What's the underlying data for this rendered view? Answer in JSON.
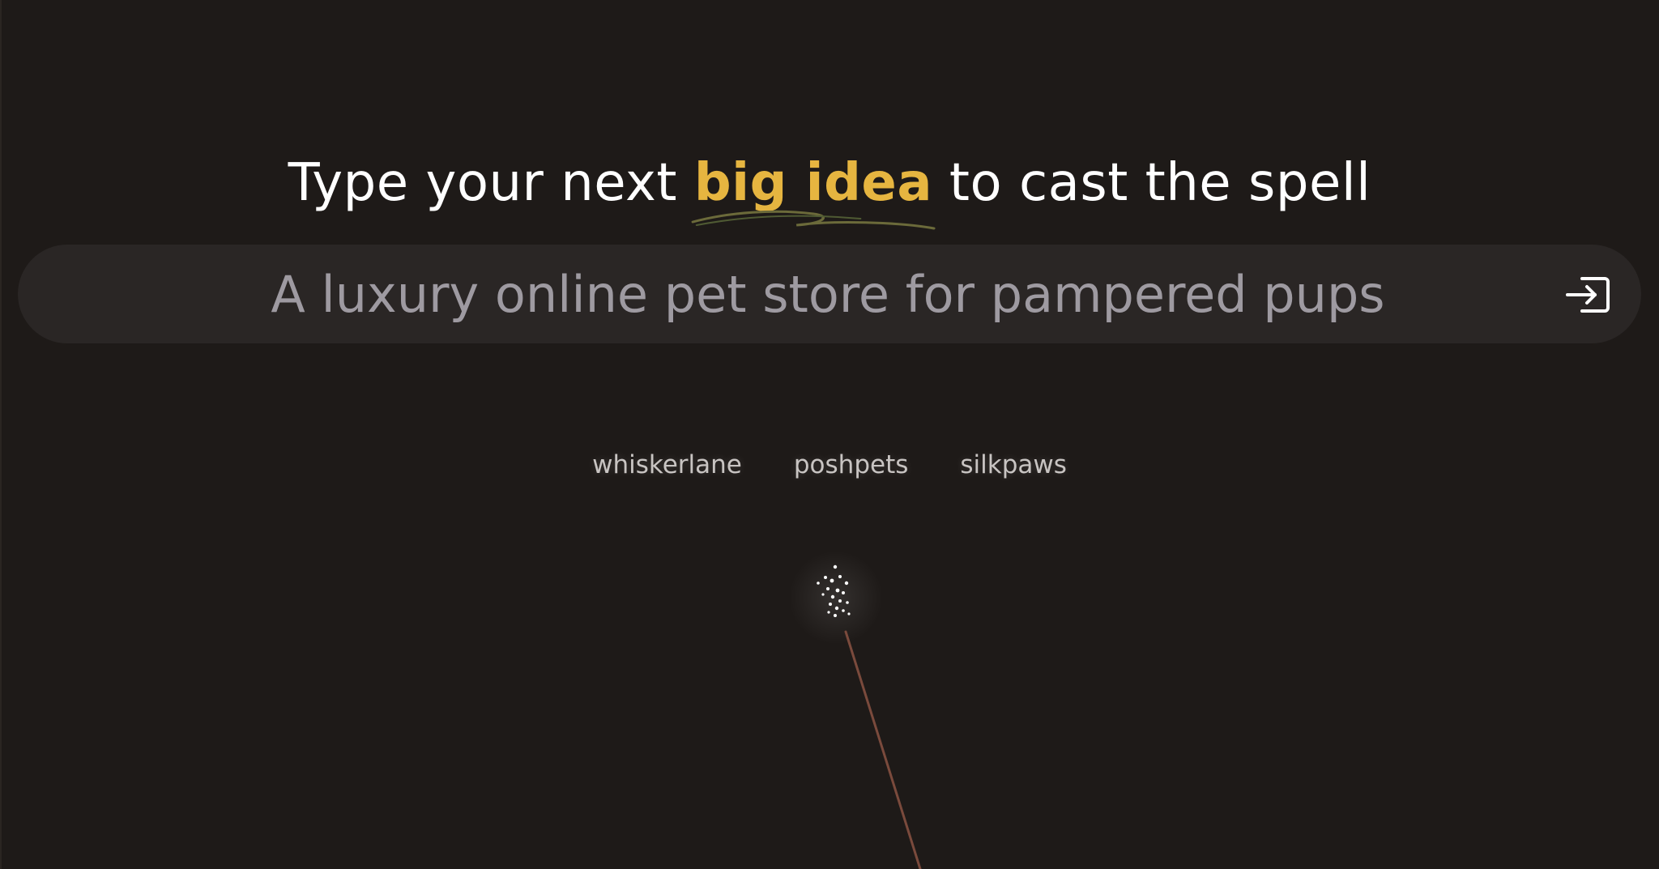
{
  "heading": {
    "before": "Type your next ",
    "accent": "big idea",
    "after": " to cast the spell"
  },
  "search": {
    "placeholder": "A luxury online pet store for pampered pups",
    "submit_icon": "login-arrow-icon"
  },
  "suggestions": [
    {
      "label": "whiskerlane"
    },
    {
      "label": "poshpets"
    },
    {
      "label": "silkpaws"
    }
  ],
  "decor": {
    "wand_icon": "magic-wand-icon",
    "sparkles_icon": "sparkles-icon"
  },
  "colors": {
    "background": "#1e1a18",
    "accent": "#e6b540",
    "search_bg": "#2a2625",
    "placeholder": "#9e9aa1",
    "suggestion": "#c8c4c2",
    "wand": "#7a4a3c"
  }
}
